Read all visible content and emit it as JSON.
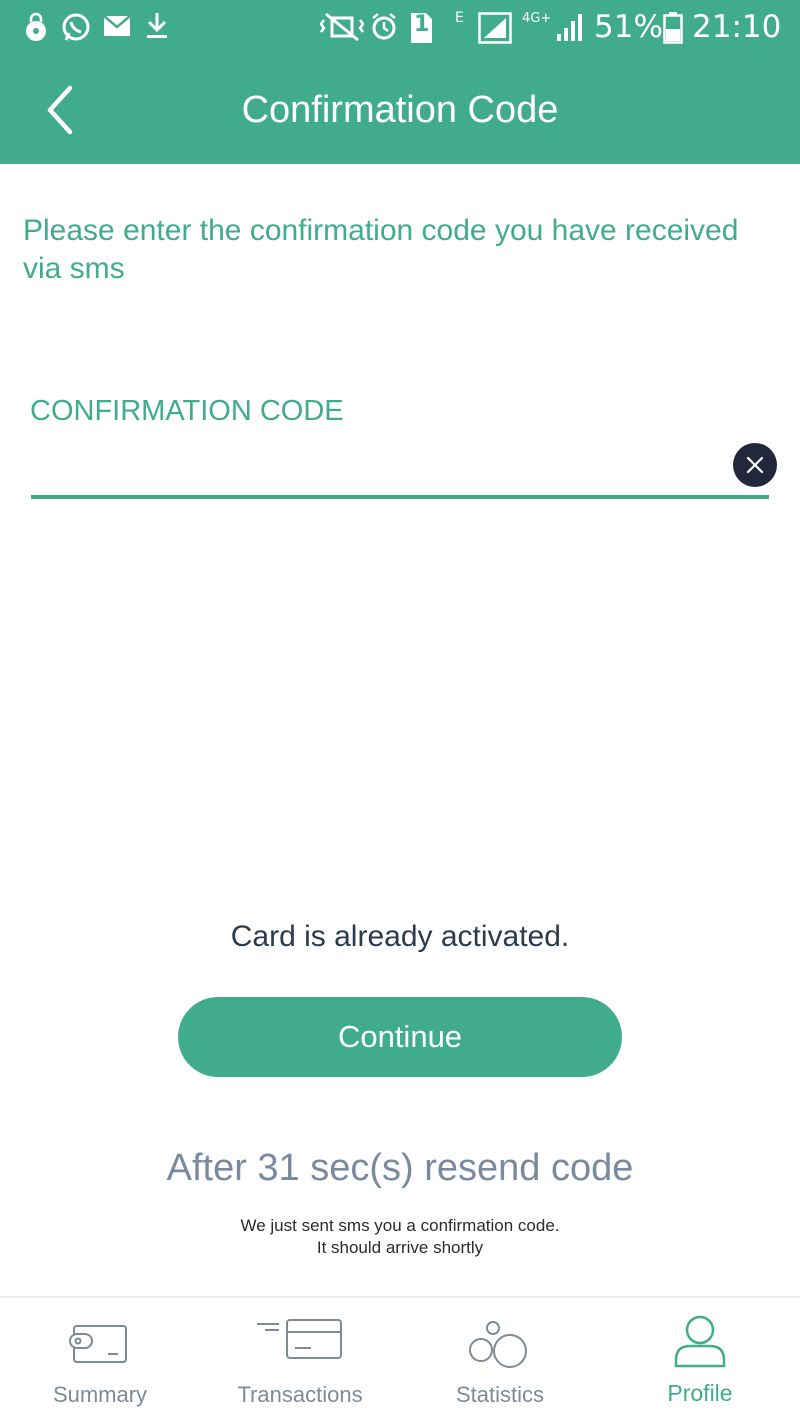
{
  "status_bar": {
    "battery": "51%",
    "time": "21:10",
    "network_type": "4G+",
    "edge_label": "E",
    "sim_slot": "1"
  },
  "header": {
    "title": "Confirmation Code"
  },
  "instructions": "Please enter the confirmation code you have received via sms",
  "code_field": {
    "label": "CONFIRMATION CODE",
    "value": "",
    "placeholder": ""
  },
  "message": "Card is already activated.",
  "continue_label": "Continue",
  "resend_text": "After 31 sec(s) resend code",
  "sent_note": {
    "line1": "We just sent sms you a confirmation code.",
    "line2": "It should arrive shortly"
  },
  "bottom_nav": {
    "items": [
      {
        "label": "Summary",
        "icon": "wallet-icon",
        "active": false
      },
      {
        "label": "Transactions",
        "icon": "card-transactions-icon",
        "active": false
      },
      {
        "label": "Statistics",
        "icon": "bubbles-statistics-icon",
        "active": false
      },
      {
        "label": "Profile",
        "icon": "person-icon",
        "active": true
      }
    ]
  },
  "colors": {
    "primary": "#40ac8c",
    "dark_text": "#2c3a4e",
    "muted_text": "#7a8a9e",
    "clear_button": "#22283c"
  }
}
